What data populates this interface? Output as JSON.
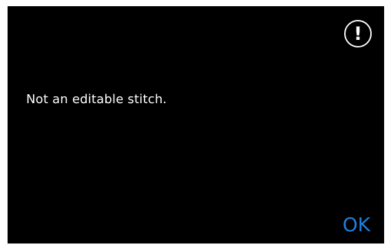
{
  "dialog": {
    "message": "Not an editable stitch.",
    "icon": "exclamation-circle-icon",
    "icon_glyph": "!",
    "ok_label": "OK"
  },
  "colors": {
    "background": "#000000",
    "text": "#ffffff",
    "accent": "#1f7fe0"
  }
}
